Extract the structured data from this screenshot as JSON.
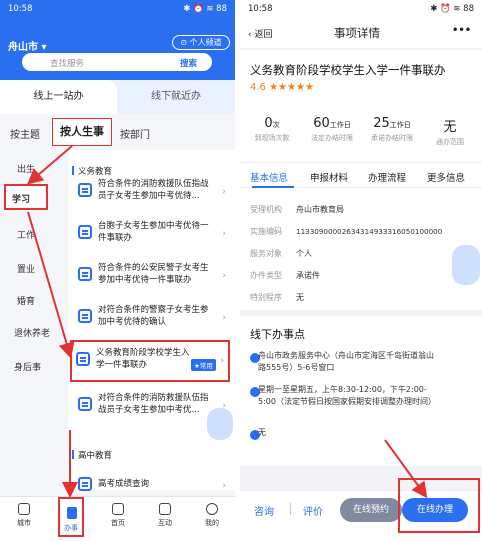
{
  "left": {
    "status": {
      "time": "10:58",
      "icons": "✱ ⏰ ≋ 88"
    },
    "city": "舟山市 ▾",
    "channel": "⊙ 个人频道",
    "search": {
      "placeholder": "查找服务",
      "button": "搜索"
    },
    "main_tabs": [
      "线上一站办",
      "线下就近办"
    ],
    "sub_tabs": [
      "按主题",
      "按人生事",
      "按部门"
    ],
    "side_nav": [
      "出生",
      "学习",
      "工作",
      "置业",
      "婚育",
      "退休养老",
      "身后事"
    ],
    "section1": "义务教育",
    "items": [
      "符合条件的消防救援队伍指战员子女考生参加中考优待...",
      "台胞子女考生参加中考优待一件事联办",
      "符合条件的公安民警子女考生参加中考优待一件事联办",
      "对符合条件的警察子女考生参加中考优待的确认",
      "义务教育阶段学校学生入学一件事联办",
      "对符合条件的消防救援队伍指战员子女考生参加中考优..."
    ],
    "badge": "★常用",
    "section2": "高中教育",
    "item_last": "高考成绩查询",
    "bottom_nav": [
      "城市",
      "办事",
      "首页",
      "互动",
      "我的"
    ]
  },
  "right": {
    "status": {
      "time": "10:58",
      "icons": "✱ ⏰ ≋ 88"
    },
    "back": "‹ 返回",
    "header_title": "事项详情",
    "more": "•••",
    "title": "义务教育阶段学校学生入学一件事联办",
    "rating": "4.6 ★★★★★",
    "stats": [
      {
        "value": "0",
        "unit": "次",
        "label": "到现场次数"
      },
      {
        "value": "60",
        "unit": "工作日",
        "label": "法定办结时限"
      },
      {
        "value": "25",
        "unit": "工作日",
        "label": "承诺办结时限"
      },
      {
        "value": "无",
        "unit": "",
        "label": "通办范围"
      }
    ],
    "tabs": [
      "基本信息",
      "申报材料",
      "办理流程",
      "更多信息"
    ],
    "info_rows": [
      {
        "k": "受理机构",
        "v": "舟山市教育局"
      },
      {
        "k": "实施编码",
        "v": "11330900002634314933316050100000"
      },
      {
        "k": "服务对象",
        "v": "个人"
      },
      {
        "k": "办件类型",
        "v": "承诺件"
      },
      {
        "k": "特别程序",
        "v": "无"
      }
    ],
    "offline_title": "线下办事点",
    "offline_place": "舟山市政务服务中心（舟山市定海区千岛街道翁山路555号）5-6号窗口",
    "offline_time": "星期一至星期五，上午8:30-12:00，下午2:00-5:00（法定节假日按国家假期安排调整办理时间）",
    "offline_phone": "无",
    "bottom": {
      "consult": "咨询",
      "review": "评价",
      "appointment": "在线预约",
      "online": "在线办理"
    }
  }
}
